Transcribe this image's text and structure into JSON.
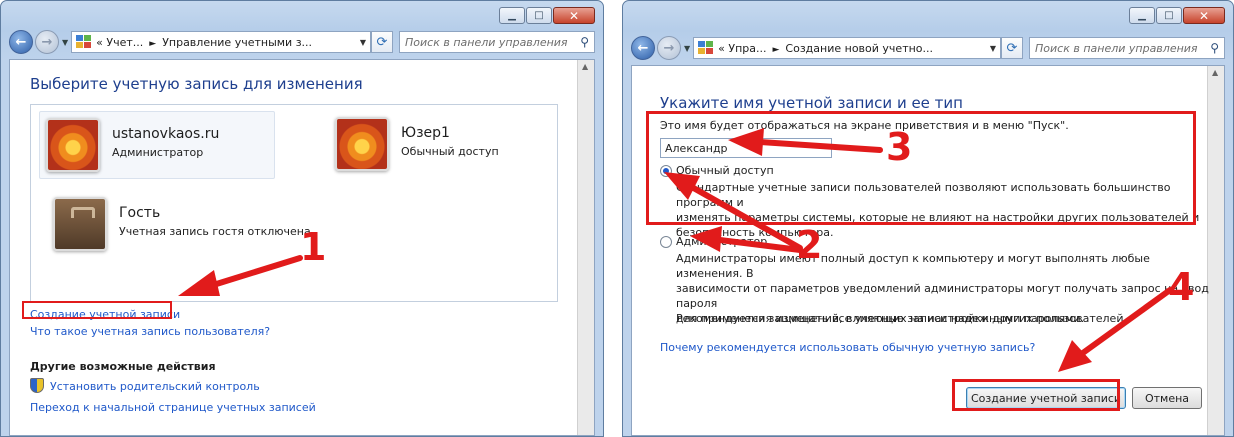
{
  "left_window": {
    "address": {
      "prefix": "«",
      "crumb1": "Учет...",
      "crumb2": "Управление учетными з..."
    },
    "search_placeholder": "Поиск в панели управления",
    "heading": "Выберите учетную запись для изменения",
    "accounts": [
      {
        "name": "ustanovkaos.ru",
        "type": "Администратор"
      },
      {
        "name": "Юзер1",
        "type": "Обычный доступ"
      },
      {
        "name": "Гость",
        "type": "Учетная запись гостя отключена"
      }
    ],
    "links": {
      "create_account": "Создание учетной записи",
      "what_is_account": "Что такое учетная запись пользователя?"
    },
    "other_actions_title": "Другие возможные действия",
    "other_actions": {
      "parental_control": "Установить родительский контроль",
      "go_to_accounts": "Переход к начальной странице учетных записей"
    }
  },
  "right_window": {
    "address": {
      "prefix": "«",
      "crumb1": "Упра...",
      "crumb2": "Создание новой учетно..."
    },
    "search_placeholder": "Поиск в панели управления",
    "heading": "Укажите имя учетной записи и ее тип",
    "name_hint": "Это имя будет отображаться на экране приветствия и в меню \"Пуск\".",
    "name_value": "Александр",
    "standard": {
      "label": "Обычный доступ",
      "line1": "Стандартные учетные записи пользователей позволяют использовать большинство программ и",
      "line2": "изменять параметры системы, которые не влияют на настройки других пользователей и",
      "line3": "безопасность компьютера.",
      "selected": true
    },
    "admin": {
      "label": "Администратор",
      "line1": "Администраторы имеют полный доступ к компьютеру и могут выполнять любые изменения. В",
      "line2": "зависимости от параметров уведомлений администраторы могут получать запрос на ввод пароля",
      "line3": "для применения изменений, влияющих на настройки других пользователей.",
      "selected": false
    },
    "recommend": "Рекомендуется защищать все учетные записи надежными паролями.",
    "why_link": "Почему рекомендуется использовать обычную учетную запись?",
    "create_button": "Создание учетной записи",
    "cancel_button": "Отмена"
  },
  "annotations": {
    "n1": "1",
    "n2": "2",
    "n3": "3",
    "n4": "4",
    "color": "#e11b1b"
  }
}
